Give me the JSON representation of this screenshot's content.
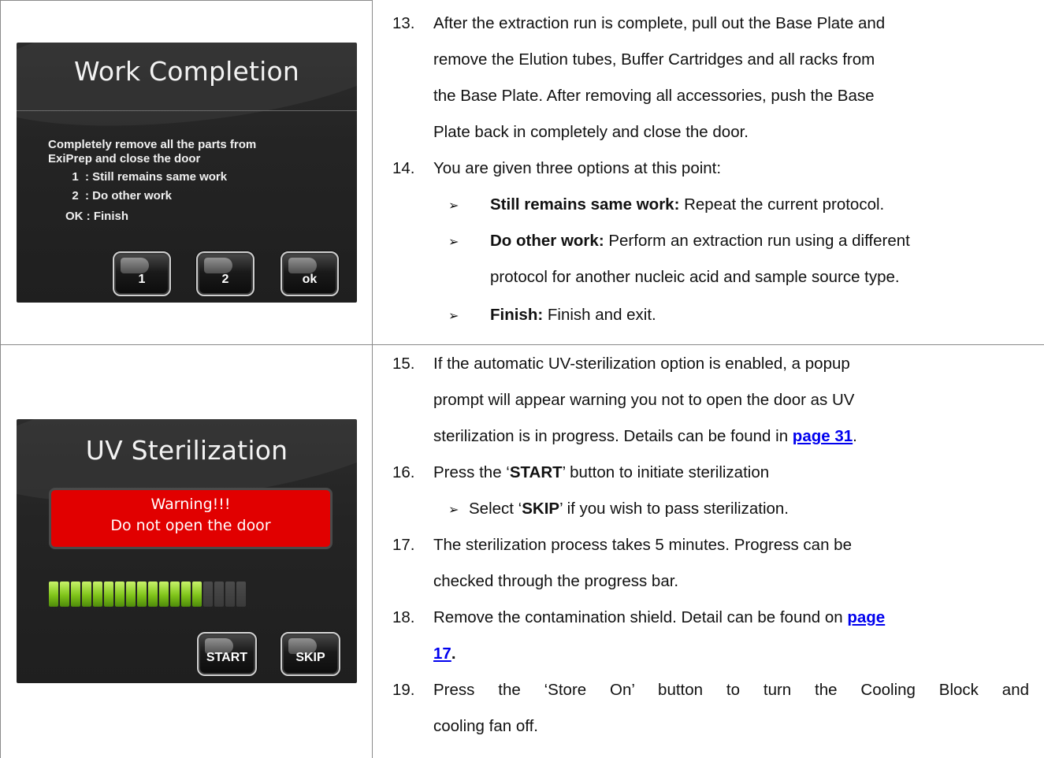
{
  "work_completion_screen": {
    "title": "Work Completion",
    "description_line1": "Completely remove all the parts from",
    "description_line2": "ExiPrep and close the door",
    "options": [
      "  1  : Still remains same work",
      "  2  : Do other work",
      "OK : Finish"
    ],
    "buttons": [
      "1",
      "2",
      "ok"
    ]
  },
  "uv_screen": {
    "title": "UV Sterilization",
    "warning_line1": "Warning!!!",
    "warning_line2": "Do not open the door",
    "progress_segments_total": 18,
    "progress_segments_filled": 14,
    "buttons": [
      "START",
      "SKIP"
    ],
    "colors": {
      "warning": "#e10000",
      "progress": "#8ccc1e"
    }
  },
  "steps": {
    "s13": {
      "num": "13.",
      "l1": "After the extraction run is complete, pull out the Base Plate and",
      "l2": "remove the Elution tubes, Buffer Cartridges and all racks from",
      "l3": "the Base Plate. After removing all accessories, push the Base",
      "l4": "Plate back in completely and close the door."
    },
    "s14": {
      "num": "14.",
      "l1": "You are given three options at this point:",
      "b1_bold": "Still remains same work:",
      "b1_text": " Repeat the current protocol.",
      "b2_bold": "Do other work:",
      "b2_text": " Perform an extraction run using a different",
      "b2_cont": "protocol for another nucleic acid and sample source type.",
      "b3_bold": "Finish:",
      "b3_text": " Finish and exit."
    },
    "s15": {
      "num": "15.",
      "l1": "If the automatic UV-sterilization option is enabled, a popup",
      "l2": "prompt will appear warning you not to open the door as UV",
      "l3_pre": "sterilization is in progress. Details can be found in ",
      "l3_link": "page 31",
      "l3_post": "."
    },
    "s16": {
      "num": "16.",
      "pre": "Press the ‘",
      "bold": "START",
      "post": "’ button to initiate sterilization",
      "sub_pre": "Select ‘",
      "sub_bold": "SKIP",
      "sub_post": "’ if you wish to pass sterilization."
    },
    "s17": {
      "num": "17.",
      "l1": "The sterilization process takes 5 minutes. Progress can be",
      "l2": "checked through the progress bar."
    },
    "s18": {
      "num": "18.",
      "l1_pre": "Remove the contamination shield. Detail can be found on ",
      "l1_link": "page ",
      "l2_link": "17",
      "l2_post": "."
    },
    "s19": {
      "num": "19.",
      "l1": "Press the ‘Store On’ button to turn the Cooling Block and",
      "l2": "cooling fan off."
    }
  },
  "bullet_glyph": "➢"
}
